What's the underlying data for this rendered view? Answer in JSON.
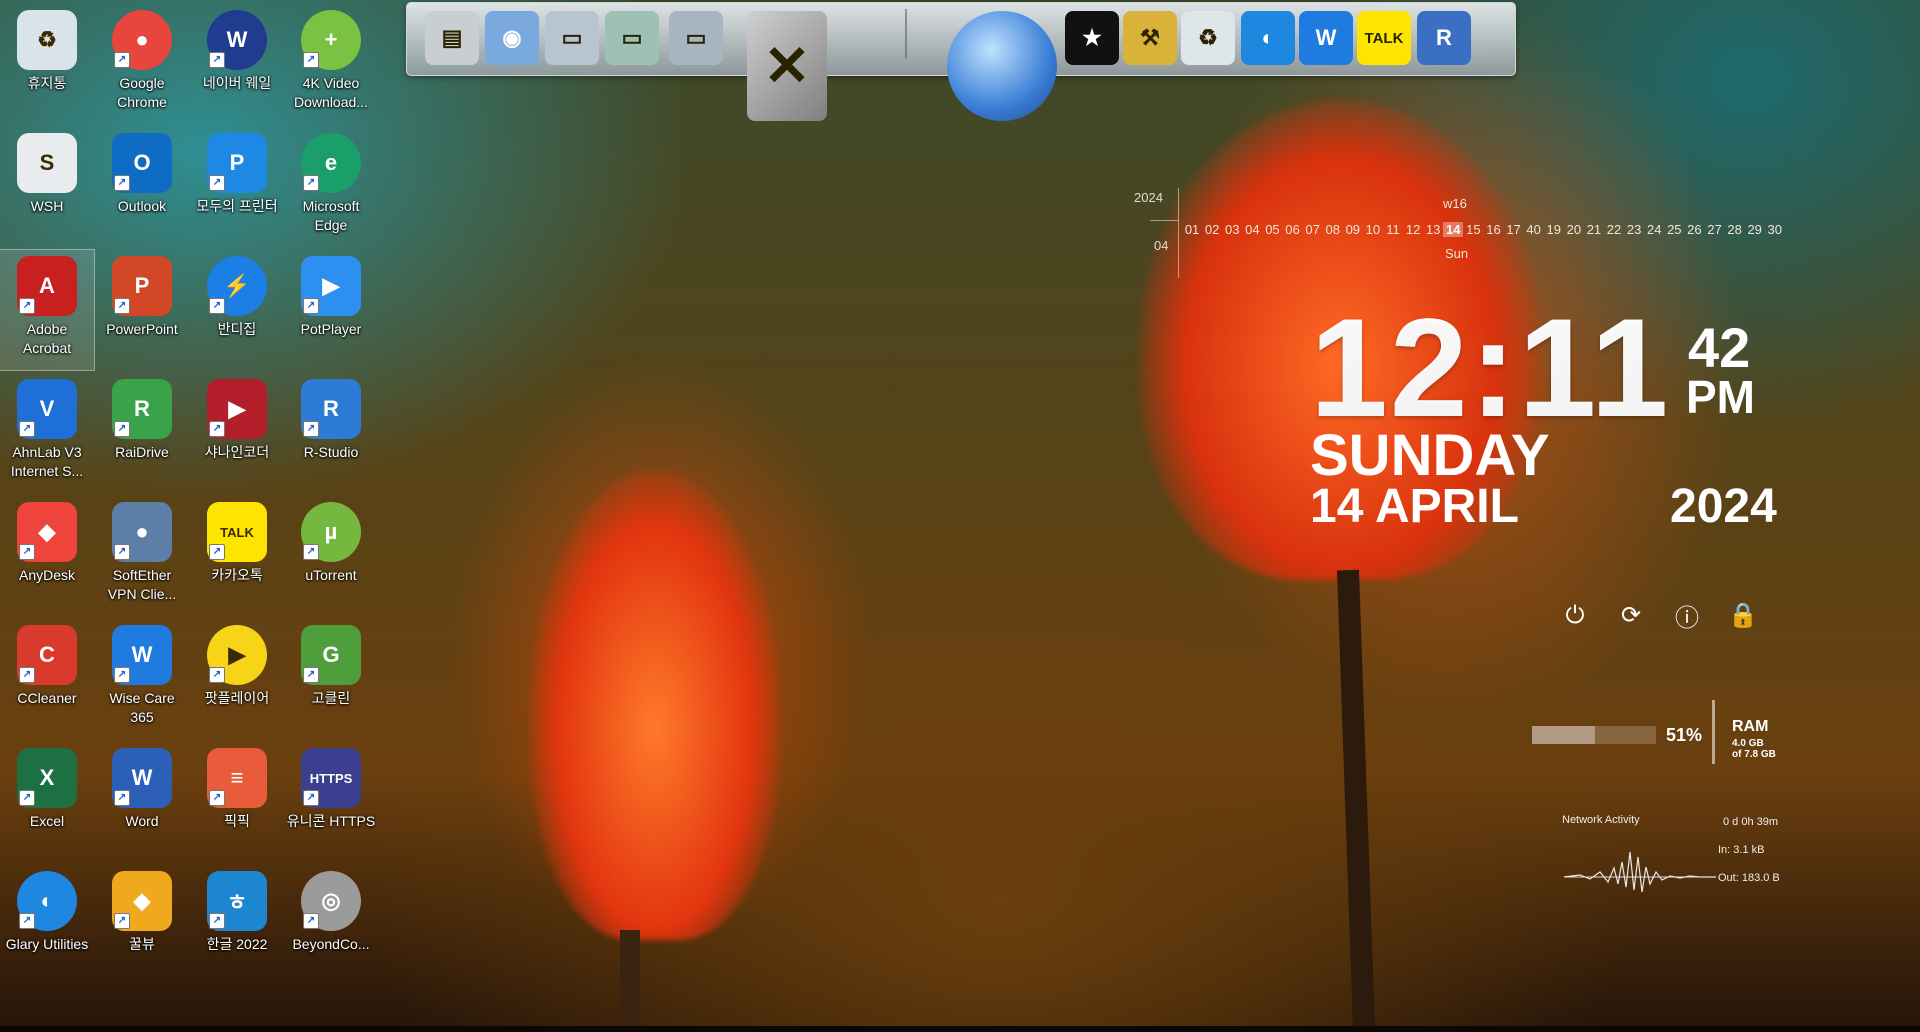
{
  "desktop": {
    "icons": [
      {
        "label": "휴지통",
        "name": "recycle-bin-icon",
        "color": "#d9e4ea",
        "glyph": "♻"
      },
      {
        "label": "Google Chrome",
        "name": "google-chrome-icon",
        "color": "#e8453c",
        "glyph": "●"
      },
      {
        "label": "네이버 웨일",
        "name": "naver-whale-icon",
        "color": "#1f3c8f",
        "glyph": "W"
      },
      {
        "label": "4K Video Download...",
        "name": "4k-video-downloader-icon",
        "color": "#7cc242",
        "glyph": "+"
      },
      {
        "label": "WSH",
        "name": "wsh-icon",
        "color": "#e9ecef",
        "glyph": "S"
      },
      {
        "label": "Outlook",
        "name": "outlook-icon",
        "color": "#0f6cc4",
        "glyph": "O"
      },
      {
        "label": "모두의 프린터",
        "name": "modu-printer-icon",
        "color": "#1e88e5",
        "glyph": "P"
      },
      {
        "label": "Microsoft Edge",
        "name": "microsoft-edge-icon",
        "color": "#1a9f6a",
        "glyph": "e"
      },
      {
        "label": "Adobe Acrobat",
        "name": "adobe-acrobat-icon",
        "color": "#c8201f",
        "glyph": "A"
      },
      {
        "label": "PowerPoint",
        "name": "powerpoint-icon",
        "color": "#d24726",
        "glyph": "P"
      },
      {
        "label": "반디집",
        "name": "bandizip-icon",
        "color": "#1c7fe6",
        "glyph": "⚡"
      },
      {
        "label": "PotPlayer",
        "name": "potplayer-icon",
        "color": "#2d8ff0",
        "glyph": "▶"
      },
      {
        "label": "AhnLab V3 Internet S...",
        "name": "ahnlab-v3-icon",
        "color": "#1f6fd8",
        "glyph": "V"
      },
      {
        "label": "RaiDrive",
        "name": "raidrive-icon",
        "color": "#3aa34a",
        "glyph": "R"
      },
      {
        "label": "샤나인코더",
        "name": "shana-encoder-icon",
        "color": "#b21e2a",
        "glyph": "▶"
      },
      {
        "label": "R-Studio",
        "name": "r-studio-icon",
        "color": "#2c7bd6",
        "glyph": "R"
      },
      {
        "label": "AnyDesk",
        "name": "anydesk-icon",
        "color": "#ef443b",
        "glyph": "◆"
      },
      {
        "label": "SoftEther VPN Clie...",
        "name": "softether-vpn-icon",
        "color": "#5c7fa8",
        "glyph": "●"
      },
      {
        "label": "카카오톡",
        "name": "kakaotalk-icon",
        "color": "#fee500",
        "glyph": "TALK"
      },
      {
        "label": "uTorrent",
        "name": "utorrent-icon",
        "color": "#76b83f",
        "glyph": "µ"
      },
      {
        "label": "CCleaner",
        "name": "ccleaner-icon",
        "color": "#d93a2b",
        "glyph": "C"
      },
      {
        "label": "Wise Care 365",
        "name": "wise-care-365-icon",
        "color": "#1f7be0",
        "glyph": "W"
      },
      {
        "label": "팟플레이어",
        "name": "kakao-potplayer-icon",
        "color": "#f7d417",
        "glyph": "▶"
      },
      {
        "label": "고클린",
        "name": "goclean-icon",
        "color": "#4e9e3b",
        "glyph": "G"
      },
      {
        "label": "Excel",
        "name": "excel-icon",
        "color": "#1d7044",
        "glyph": "X"
      },
      {
        "label": "Word",
        "name": "word-icon",
        "color": "#2b5fb8",
        "glyph": "W"
      },
      {
        "label": "픽픽",
        "name": "picpick-icon",
        "color": "#e85c3b",
        "glyph": "≡"
      },
      {
        "label": "유니콘 HTTPS",
        "name": "unicorn-https-icon",
        "color": "#3a3f8f",
        "glyph": "HTTPS"
      },
      {
        "label": "Glary Utilities",
        "name": "glary-utilities-icon",
        "color": "#1e87e0",
        "glyph": "◐"
      },
      {
        "label": "꿀뷰",
        "name": "honeyview-icon",
        "color": "#f0a91d",
        "glyph": "◆"
      },
      {
        "label": "한글 2022",
        "name": "hangul-2022-icon",
        "color": "#1c86d0",
        "glyph": "ㅎ"
      },
      {
        "label": "BeyondCo...",
        "name": "beyond-compare-icon",
        "color": "#9b9b9b",
        "glyph": "◎"
      }
    ]
  },
  "dock": {
    "items": [
      {
        "name": "dock-computer-icon",
        "glyph": "▤",
        "color": "#c9ced1"
      },
      {
        "name": "dock-network-icon",
        "glyph": "◉",
        "color": "#7aa9e0"
      },
      {
        "name": "dock-folder-icon",
        "glyph": "▭",
        "color": "#b8c4d0"
      },
      {
        "name": "dock-downloads-folder-icon",
        "glyph": "▭",
        "color": "#9fc0b5"
      },
      {
        "name": "dock-documents-folder-icon",
        "glyph": "▭",
        "color": "#a8b4c0"
      },
      {
        "name": "dock-tools-icon",
        "glyph": "✕",
        "color": "#a6a6a6"
      },
      {
        "name": "dock-globe-icon",
        "glyph": "◍",
        "color": "#3b7fd6"
      },
      {
        "name": "dock-tshirt-icon",
        "glyph": "★",
        "color": "#111111"
      },
      {
        "name": "dock-hammer-icon",
        "glyph": "⚒",
        "color": "#d9b23a"
      },
      {
        "name": "dock-recycle-bin-icon",
        "glyph": "♻",
        "color": "#dfe6ea"
      },
      {
        "name": "dock-glary-icon",
        "glyph": "◐",
        "color": "#1e87e0"
      },
      {
        "name": "dock-wise-care-icon",
        "glyph": "W",
        "color": "#1f7be0"
      },
      {
        "name": "dock-kakaotalk-icon",
        "glyph": "TALK",
        "color": "#fee500"
      },
      {
        "name": "dock-r-studio-icon",
        "glyph": "R",
        "color": "#3a6fc4"
      }
    ]
  },
  "calendar": {
    "year": "2024",
    "month": "04",
    "week": "w16",
    "day_name": "Sun",
    "today": "14",
    "days": [
      "01",
      "02",
      "03",
      "04",
      "05",
      "06",
      "07",
      "08",
      "09",
      "10",
      "11",
      "12",
      "13",
      "14",
      "15",
      "16",
      "17",
      "40",
      "19",
      "20",
      "21",
      "22",
      "23",
      "24",
      "25",
      "26",
      "27",
      "28",
      "29",
      "30"
    ]
  },
  "clock": {
    "time": "12:11",
    "seconds": "42",
    "ampm": "PM",
    "weekday": "SUNDAY",
    "date": "14 APRIL",
    "year": "2024"
  },
  "power": {
    "buttons": [
      {
        "name": "shutdown-button",
        "glyph": "⏻"
      },
      {
        "name": "restart-button",
        "glyph": "⟳"
      },
      {
        "name": "logoff-button",
        "glyph": "ⓘ"
      },
      {
        "name": "lock-button",
        "glyph": "🔒"
      }
    ]
  },
  "ram": {
    "percent_label": "51%",
    "percent": 51,
    "label": "RAM",
    "used": "4.0 GB",
    "total": "of 7.8 GB"
  },
  "network": {
    "title": "Network Activity",
    "uptime": "0 d 0h 39m",
    "in": "In: 3.1 kB",
    "out": "Out: 183.0 B"
  }
}
